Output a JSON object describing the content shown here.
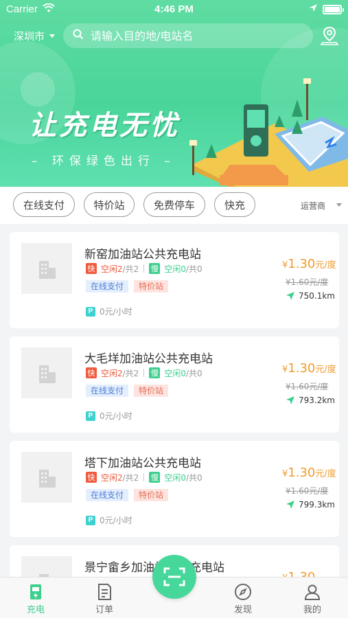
{
  "status_bar": {
    "carrier": "Carrier",
    "time": "4:46 PM"
  },
  "header": {
    "city": "深圳市",
    "search_placeholder": "请输入目的地/电站名",
    "slogan": "让充电无忧",
    "subslogan": "– 环保绿色出行 –"
  },
  "filters": {
    "chips": [
      "在线支付",
      "特价站",
      "免费停车",
      "快充"
    ],
    "operator": "运营商"
  },
  "stations": [
    {
      "name": "新窑加油站公共充电站",
      "fast_badge": "快",
      "fast_free": "空闲2",
      "fast_total": "/共2",
      "slow_badge": "慢",
      "slow_free": "空闲0",
      "slow_total": "/共0",
      "tags": [
        "在线支付",
        "特价站"
      ],
      "parking": "0元/小时",
      "currency": "¥",
      "price": "1.30",
      "price_unit": "元/度",
      "old_price": "¥1.60元/度",
      "distance": "750.1km"
    },
    {
      "name": "大毛垟加油站公共充电站",
      "fast_badge": "快",
      "fast_free": "空闲2",
      "fast_total": "/共2",
      "slow_badge": "慢",
      "slow_free": "空闲0",
      "slow_total": "/共0",
      "tags": [
        "在线支付",
        "特价站"
      ],
      "parking": "0元/小时",
      "currency": "¥",
      "price": "1.30",
      "price_unit": "元/度",
      "old_price": "¥1.60元/度",
      "distance": "793.2km"
    },
    {
      "name": "塔下加油站公共充电站",
      "fast_badge": "快",
      "fast_free": "空闲2",
      "fast_total": "/共2",
      "slow_badge": "慢",
      "slow_free": "空闲0",
      "slow_total": "/共0",
      "tags": [
        "在线支付",
        "特价站"
      ],
      "parking": "0元/小时",
      "currency": "¥",
      "price": "1.30",
      "price_unit": "元/度",
      "old_price": "¥1.60元/度",
      "distance": "799.3km"
    },
    {
      "name": "景宁畲乡加油站公共充电站",
      "currency": "¥",
      "price": "1.30"
    }
  ],
  "tabbar": {
    "tabs": [
      {
        "label": "充电",
        "icon": "charging-station-icon",
        "active": true
      },
      {
        "label": "订单",
        "icon": "order-list-icon",
        "active": false
      },
      {
        "label": "发现",
        "icon": "compass-icon",
        "active": false
      },
      {
        "label": "我的",
        "icon": "user-icon",
        "active": false
      }
    ],
    "center_icon": "scan-icon"
  },
  "colors": {
    "brand_green": "#46d79b",
    "fast_red": "#ef5a3c",
    "price_orange": "#f29a2b",
    "slow_green": "#3ecf8e"
  }
}
